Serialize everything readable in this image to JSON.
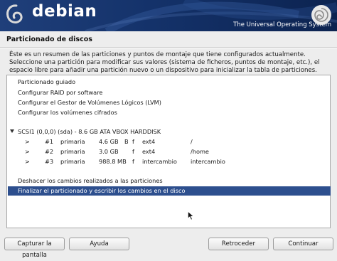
{
  "header": {
    "brand": "debian",
    "tagline": "The Universal Operating System"
  },
  "page": {
    "title": "Particionado de discos",
    "intro": "Éste es un resumen de las particiones y puntos de montaje que tiene configurados actualmente. Seleccione una partición para modificar sus valores (sistema de ficheros, puntos de montaje, etc.), el espacio libre para añadir una partición nuevo o un dispositivo para inicializar la tabla de particiones."
  },
  "menu": {
    "guided": "Particionado guiado",
    "raid": "Configurar RAID por software",
    "lvm": "Configurar el Gestor de Volúmenes Lógicos (LVM)",
    "crypto": "Configurar los volúmenes cifrados",
    "disk": "SCSI1 (0,0,0) (sda) - 8.6 GB ATA VBOX HARDDISK",
    "undo": "Deshacer los cambios realizados a las particiones",
    "finish": "Finalizar el particionado y escribir los cambios en el disco"
  },
  "partitions": [
    {
      "arrow": ">",
      "num": "#1",
      "type": "primaria",
      "size": "4.6 GB",
      "boot": "B",
      "fmt": "f",
      "fs": "ext4",
      "mount": "/"
    },
    {
      "arrow": ">",
      "num": "#2",
      "type": "primaria",
      "size": "3.0 GB",
      "boot": "",
      "fmt": "f",
      "fs": "ext4",
      "mount": "/home"
    },
    {
      "arrow": ">",
      "num": "#3",
      "type": "primaria",
      "size": "988.8 MB",
      "boot": "",
      "fmt": "f",
      "fs": "intercambio",
      "mount": "intercambio"
    }
  ],
  "buttons": {
    "screenshot": "Capturar la pantalla",
    "help": "Ayuda",
    "back": "Retroceder",
    "continue": "Continuar"
  },
  "colors": {
    "selection": "#2d4f8e",
    "banner": "#14326a"
  }
}
